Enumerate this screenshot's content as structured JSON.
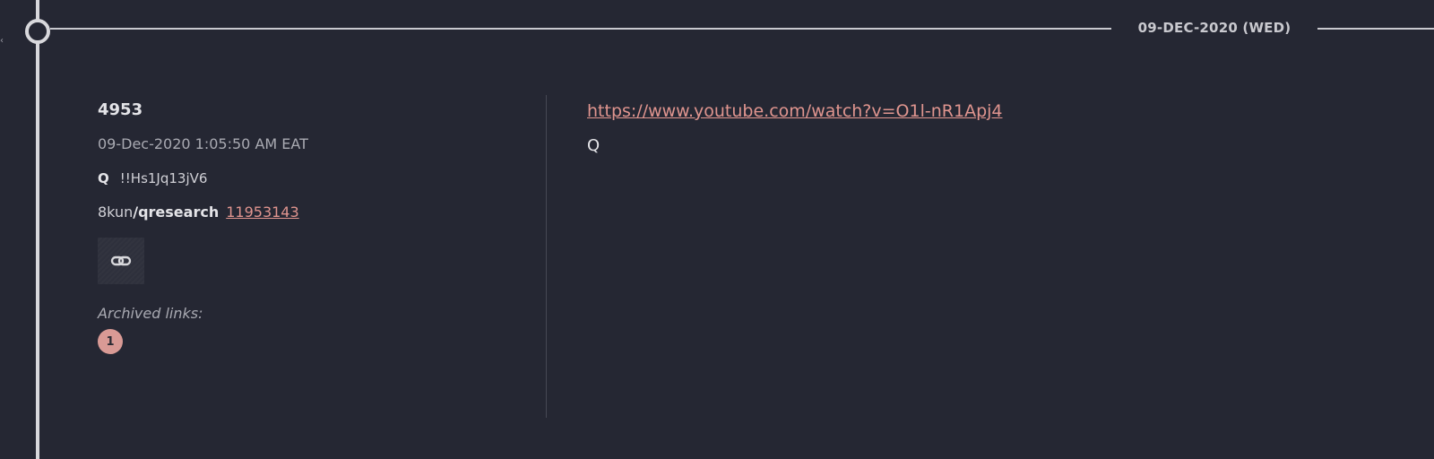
{
  "timeline": {
    "date_header": "09-DEC-2020 (WED)"
  },
  "post": {
    "number": "4953",
    "timestamp": "09-Dec-2020 1:05:50 AM EAT",
    "author": "Q",
    "tripcode": "!!Hs1Jq13jV6",
    "source_site": "8kun",
    "board": "/qresearch",
    "post_id": "11953143",
    "link_button_icon": "chain-link-icon",
    "archived_label": "Archived links:",
    "archived_links": [
      "1"
    ],
    "content_link": "https://www.youtube.com/watch?v=O1l-nR1Apj4",
    "content_text": "Q"
  },
  "colors": {
    "background": "#252733",
    "accent_link": "#e0958f",
    "badge": "#d99a95"
  }
}
